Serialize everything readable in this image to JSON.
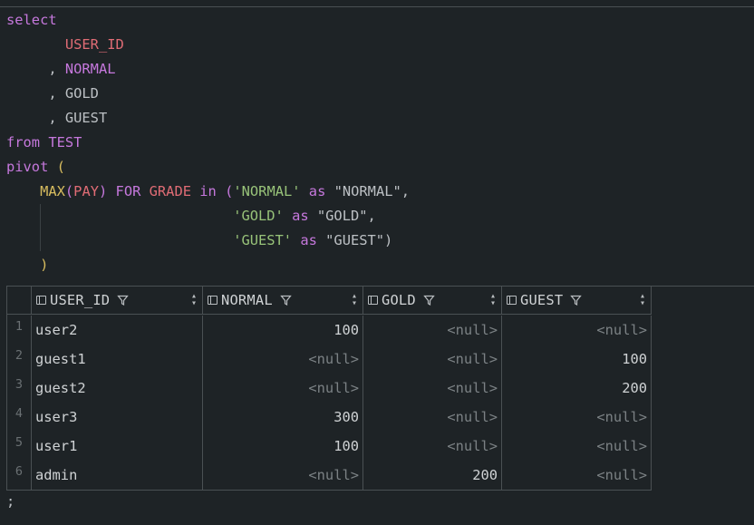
{
  "editor": {
    "lines": [
      [
        {
          "t": "select",
          "c": "kw"
        }
      ],
      [
        {
          "t": "       ",
          "c": "plain"
        },
        {
          "t": "USER_ID",
          "c": "id"
        }
      ],
      [
        {
          "t": "     , ",
          "c": "plain"
        },
        {
          "t": "NORMAL",
          "c": "kw"
        }
      ],
      [
        {
          "t": "     , ",
          "c": "plain"
        },
        {
          "t": "GOLD",
          "c": "plain"
        }
      ],
      [
        {
          "t": "     , ",
          "c": "plain"
        },
        {
          "t": "GUEST",
          "c": "plain"
        }
      ],
      [
        {
          "t": "from",
          "c": "kw"
        },
        {
          "t": " ",
          "c": "plain"
        },
        {
          "t": "TEST",
          "c": "kw"
        }
      ],
      [
        {
          "t": "pivot",
          "c": "kw"
        },
        {
          "t": " ",
          "c": "plain"
        },
        {
          "t": "(",
          "c": "fn"
        }
      ],
      [
        {
          "t": "    ",
          "c": "plain"
        },
        {
          "t": "MAX",
          "c": "fn"
        },
        {
          "t": "(",
          "c": "kw"
        },
        {
          "t": "PAY",
          "c": "id"
        },
        {
          "t": ")",
          "c": "kw"
        },
        {
          "t": " ",
          "c": "plain"
        },
        {
          "t": "FOR",
          "c": "kw"
        },
        {
          "t": " ",
          "c": "plain"
        },
        {
          "t": "GRADE",
          "c": "id"
        },
        {
          "t": " ",
          "c": "plain"
        },
        {
          "t": "in",
          "c": "kw"
        },
        {
          "t": " ",
          "c": "plain"
        },
        {
          "t": "(",
          "c": "kw"
        },
        {
          "t": "'NORMAL'",
          "c": "str"
        },
        {
          "t": " ",
          "c": "plain"
        },
        {
          "t": "as",
          "c": "kw"
        },
        {
          "t": " \"NORMAL\",",
          "c": "plain"
        }
      ],
      [
        {
          "t": "                           ",
          "c": "plain"
        },
        {
          "t": "'GOLD'",
          "c": "str"
        },
        {
          "t": " ",
          "c": "plain"
        },
        {
          "t": "as",
          "c": "kw"
        },
        {
          "t": " \"GOLD\",",
          "c": "plain"
        }
      ],
      [
        {
          "t": "                           ",
          "c": "plain"
        },
        {
          "t": "'GUEST'",
          "c": "str"
        },
        {
          "t": " ",
          "c": "plain"
        },
        {
          "t": "as",
          "c": "kw"
        },
        {
          "t": " \"GUEST\")",
          "c": "plain"
        }
      ],
      [
        {
          "t": "    ",
          "c": "plain"
        },
        {
          "t": ")",
          "c": "fn"
        }
      ]
    ],
    "trailing": ";"
  },
  "results": {
    "columns": [
      "USER_ID",
      "NORMAL",
      "GOLD",
      "GUEST"
    ],
    "rows": [
      {
        "n": "1",
        "cells": [
          "user2",
          "100",
          "<null>",
          "<null>"
        ]
      },
      {
        "n": "2",
        "cells": [
          "guest1",
          "<null>",
          "<null>",
          "100"
        ]
      },
      {
        "n": "3",
        "cells": [
          "guest2",
          "<null>",
          "<null>",
          "200"
        ]
      },
      {
        "n": "4",
        "cells": [
          "user3",
          "300",
          "<null>",
          "<null>"
        ]
      },
      {
        "n": "5",
        "cells": [
          "user1",
          "100",
          "<null>",
          "<null>"
        ]
      },
      {
        "n": "6",
        "cells": [
          "admin",
          "<null>",
          "200",
          "<null>"
        ]
      }
    ]
  },
  "colors": {
    "background": "#1e2326",
    "keyword": "#c678dd",
    "identifier": "#e06c75",
    "function": "#d8bd5f",
    "string": "#98c379",
    "null": "#7b8184"
  }
}
